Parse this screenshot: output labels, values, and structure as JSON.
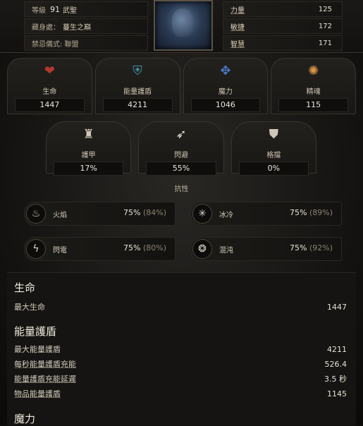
{
  "character": {
    "level_label": "等級",
    "level": "91",
    "class": "武聖",
    "hideout_label": "藏身處：",
    "hideout": "蔓生之巔",
    "ritual": "禁忌儀式: 聯盟"
  },
  "attributes": [
    {
      "name": "力量",
      "value": "125"
    },
    {
      "name": "敏捷",
      "value": "172"
    },
    {
      "name": "智慧",
      "value": "171"
    }
  ],
  "main_stats": [
    {
      "label": "生命",
      "value": "1447",
      "icon": "heart-icon",
      "color": "#b5382e"
    },
    {
      "label": "能量護盾",
      "value": "4211",
      "icon": "shield-icon",
      "color": "#3f8fa3"
    },
    {
      "label": "魔力",
      "value": "1046",
      "icon": "mana-icon",
      "color": "#4a78c8"
    },
    {
      "label": "精魂",
      "value": "115",
      "icon": "spirit-icon",
      "color": "#d9934a"
    }
  ],
  "defense_stats": [
    {
      "label": "護甲",
      "value": "17%",
      "icon": "armour-icon"
    },
    {
      "label": "閃避",
      "value": "55%",
      "icon": "evasion-icon"
    },
    {
      "label": "格擋",
      "value": "0%",
      "icon": "block-icon"
    }
  ],
  "resist_title": "抗性",
  "resistances": [
    {
      "name": "火焰",
      "value": "75%",
      "cap": "(84%)",
      "icon": "fire-icon"
    },
    {
      "name": "冰冷",
      "value": "75%",
      "cap": "(89%)",
      "icon": "cold-icon"
    },
    {
      "name": "閃電",
      "value": "75%",
      "cap": "(80%)",
      "icon": "lightning-icon"
    },
    {
      "name": "混沌",
      "value": "75%",
      "cap": "(92%)",
      "icon": "chaos-icon"
    }
  ],
  "details": {
    "life": {
      "title": "生命",
      "rows": [
        {
          "k": "最大生命",
          "v": "1447"
        }
      ]
    },
    "energy_shield": {
      "title": "能量護盾",
      "rows": [
        {
          "k": "最大能量護盾",
          "v": "4211"
        },
        {
          "k": "每秒能量護盾充能",
          "v": "526.4"
        },
        {
          "k": "能量護盾充能延遲",
          "v": "3.5 秒"
        },
        {
          "k": "物品能量護盾",
          "v": "1145"
        }
      ]
    },
    "mana_title": "魔力"
  }
}
